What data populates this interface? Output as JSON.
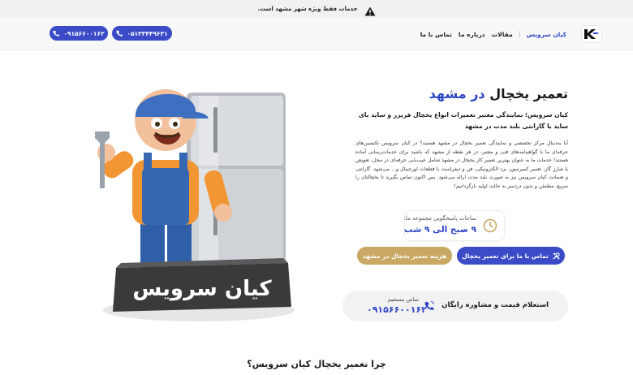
{
  "notice": {
    "text": "خدمات فقط ویژه شهر مشهد است.",
    "icon": "warning-icon"
  },
  "header": {
    "logo": "K",
    "nav": [
      "کیان سرویس",
      "مقالات",
      "درباره ما",
      "تماس با ما"
    ],
    "phone_buttons": [
      "۰۵۱۳۳۴۴۹۶۳۱",
      "۰۹۱۵۶۶۰۰۱۶۲"
    ]
  },
  "hero": {
    "title_main": "تعمیر یخچال",
    "title_accent": "در مشهد",
    "subtitle": "کیان سرویس؛ نمایندگی معتبر تعمیرات انواع یخچال فریزر و ساید بای ساید با گارانتی بلند مدت در مشهد",
    "description": "آیا به‌دنبال مرکز تخصصی و نمایندگی تعمیر یخچال در مشهد هستید؟ در کیان سرویس تکنسین‌های حرفه‌ای ما با گواهینامه‌های فنی و معتبر، در هر نقطه از مشهد که باشید برای خدمات‌رسانی آماده هستند! خدمات ما به عنوان بهترین تعمیر کار یخچال در مشهد شامل عیب‌یابی حرفه‌ای در محل، تعویض یا شارژ گاز، تعمیر کمپرسور، برد الکترونیکی، فن و دیفراست با قطعات اورجینال و... می‌شود. گارانتی و ضمانت کیان سرویس نیز به صورت بلند مدت ارائه می‌شود. پس اکنون تماس بگیرید تا یخچالتان را سریع، مطمئن و بدون دردسر به حالت اولیه بازگردانیم!",
    "hours_label": "ساعات پاسخگویی مجموعه ما:",
    "hours_value": "۹ صبح الی ۹ شب",
    "cta_primary": "تماس با ما برای تعمیر یخچال",
    "cta_secondary": "هزینه تعمیر یخچال در مشهد",
    "consult_title": "استعلام قیمت و مشاوره رایگان",
    "direct_label": "تماس مستقیم",
    "direct_number": "۰۹۱۵۶۶۰۰۱۶۲"
  },
  "illustration": {
    "brand_text": "کیان سرویس"
  },
  "section": {
    "title": "چرا تعمیر یخچال کیان سرویس؟"
  },
  "colors": {
    "primary": "#3b4bc8",
    "accent": "#2e46c6",
    "gold": "#c9a864"
  }
}
